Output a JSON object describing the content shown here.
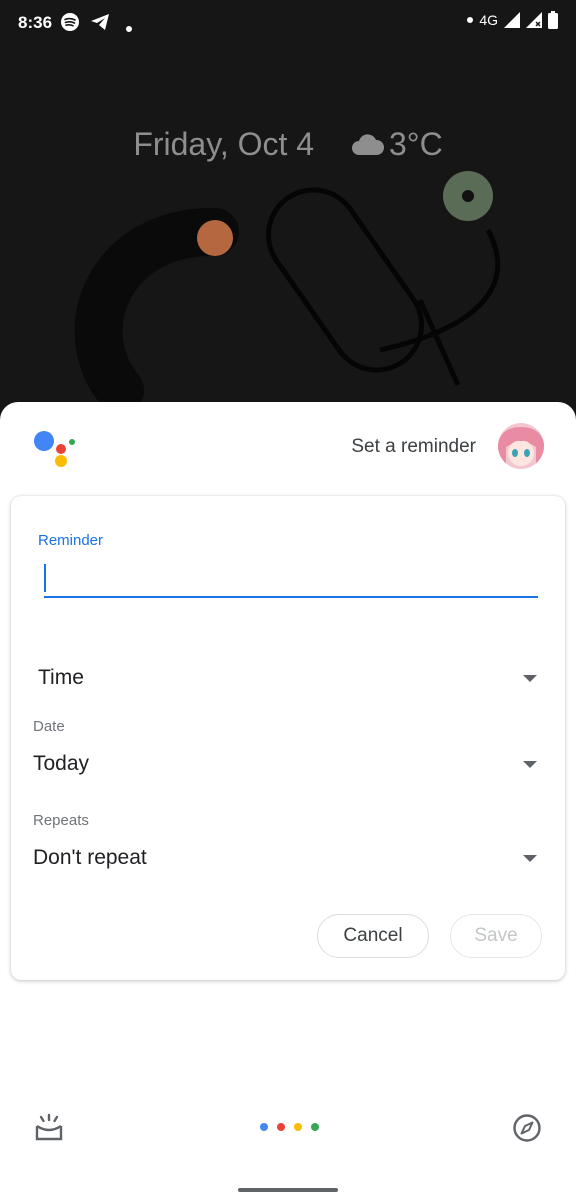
{
  "status_bar": {
    "time": "8:36",
    "network": "4G"
  },
  "wallpaper": {
    "date": "Friday, Oct 4",
    "temperature": "3°C"
  },
  "assistant": {
    "title": "Set a reminder",
    "form": {
      "reminder_label": "Reminder",
      "reminder_value": "",
      "time_value": "Time",
      "date_label": "Date",
      "date_value": "Today",
      "repeats_label": "Repeats",
      "repeats_value": "Don't repeat",
      "cancel_label": "Cancel",
      "save_label": "Save"
    }
  },
  "colors": {
    "accent": "#1a73e8",
    "google_blue": "#4285f4",
    "google_red": "#ea4335",
    "google_yellow": "#fbbc05",
    "google_green": "#34a853"
  },
  "icons": [
    "spotify-icon",
    "telegram-icon",
    "signal-icon",
    "battery-icon",
    "cloud-icon",
    "snapshot-icon",
    "explore-icon"
  ]
}
